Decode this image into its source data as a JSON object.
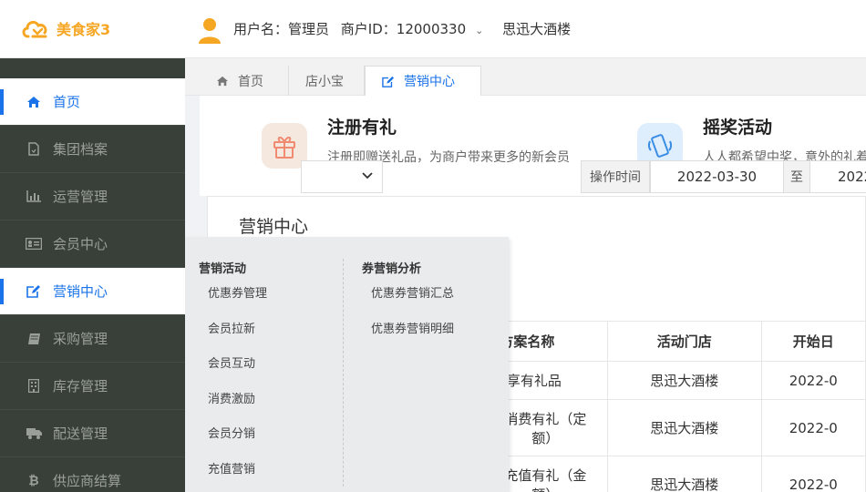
{
  "app": {
    "name": "美食家3"
  },
  "header": {
    "username": "用户名：管理员",
    "merchant_id": "商户ID：12000330",
    "store": "思迅大酒楼"
  },
  "sidebar": {
    "items": [
      {
        "label": "首页",
        "icon": "home-icon",
        "active": true
      },
      {
        "label": "集团档案",
        "icon": "file-icon"
      },
      {
        "label": "运营管理",
        "icon": "bar-chart-icon"
      },
      {
        "label": "会员中心",
        "icon": "id-card-icon"
      },
      {
        "label": "营销中心",
        "icon": "edit-icon",
        "active": true
      },
      {
        "label": "采购管理",
        "icon": "book-icon"
      },
      {
        "label": "库存管理",
        "icon": "building-icon"
      },
      {
        "label": "配送管理",
        "icon": "truck-icon"
      },
      {
        "label": "供应商结算",
        "icon": "bitcoin-icon"
      }
    ]
  },
  "tabs": [
    {
      "label": "首页",
      "icon": "home-icon"
    },
    {
      "label": "店小宝"
    },
    {
      "label": "营销中心",
      "icon": "edit-icon",
      "active": true
    }
  ],
  "promos": [
    {
      "title": "注册有礼",
      "desc": "注册即赠送礼品，为商户带来更多的新会员",
      "icon": "gift-icon"
    },
    {
      "title": "摇奖活动",
      "desc": "人人都希望中奖，意外的礼着顾客的就餐...",
      "icon": "phone-shake-icon"
    }
  ],
  "panel": {
    "title": "营销中心",
    "time_label": "操作时间",
    "date_from": "2022-03-30",
    "to_label": "至",
    "date_to": "2022"
  },
  "table": {
    "headers": [
      "方案名称",
      "活动门店",
      "开始日"
    ],
    "rows": [
      {
        "name": "分享有礼品",
        "store": "思迅大酒楼",
        "start": "2022-0"
      },
      {
        "name": "消费有礼（定额）",
        "store": "思迅大酒楼",
        "start": "2022-0"
      },
      {
        "name": "充值有礼（金额）",
        "store": "思迅大酒楼",
        "start": "2022-0"
      }
    ]
  },
  "flyout": {
    "col1": {
      "heading": "营销活动",
      "items": [
        "优惠券管理",
        "会员拉新",
        "会员互动",
        "消费激励",
        "会员分销",
        "充值营销"
      ]
    },
    "col2": {
      "heading": "券营销分析",
      "items": [
        "优惠券营销汇总",
        "优惠券营销明细"
      ]
    }
  },
  "colors": {
    "accent": "#1a73e8",
    "sidebar_bg": "#394039",
    "logo": "#f6a623"
  }
}
